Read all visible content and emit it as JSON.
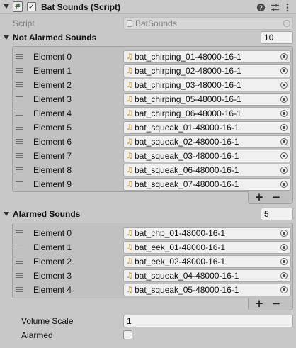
{
  "component": {
    "title": "Bat Sounds (Script)",
    "script_icon_glyph": "#",
    "enabled_glyph": "✓",
    "help_icon": "question-circle-icon",
    "presets_icon": "sliders-icon",
    "menu_icon": "kebab-menu-icon"
  },
  "script_row": {
    "label": "Script",
    "value": "BatSounds"
  },
  "not_alarmed": {
    "label": "Not Alarmed Sounds",
    "size": "10",
    "elements": [
      {
        "label": "Element 0",
        "value": "bat_chirping_01-48000-16-1"
      },
      {
        "label": "Element 1",
        "value": "bat_chirping_02-48000-16-1"
      },
      {
        "label": "Element 2",
        "value": "bat_chirping_03-48000-16-1"
      },
      {
        "label": "Element 3",
        "value": "bat_chirping_05-48000-16-1"
      },
      {
        "label": "Element 4",
        "value": "bat_chirping_06-48000-16-1"
      },
      {
        "label": "Element 5",
        "value": "bat_squeak_01-48000-16-1"
      },
      {
        "label": "Element 6",
        "value": "bat_squeak_02-48000-16-1"
      },
      {
        "label": "Element 7",
        "value": "bat_squeak_03-48000-16-1"
      },
      {
        "label": "Element 8",
        "value": "bat_squeak_06-48000-16-1"
      },
      {
        "label": "Element 9",
        "value": "bat_squeak_07-48000-16-1"
      }
    ]
  },
  "alarmed": {
    "label": "Alarmed Sounds",
    "size": "5",
    "elements": [
      {
        "label": "Element 0",
        "value": "bat_chp_01-48000-16-1"
      },
      {
        "label": "Element 1",
        "value": "bat_eek_01-48000-16-1"
      },
      {
        "label": "Element 2",
        "value": "bat_eek_02-48000-16-1"
      },
      {
        "label": "Element 3",
        "value": "bat_squeak_04-48000-16-1"
      },
      {
        "label": "Element 4",
        "value": "bat_squeak_05-48000-16-1"
      }
    ]
  },
  "list_buttons": {
    "add": "+",
    "remove": "−"
  },
  "volume_scale": {
    "label": "Volume Scale",
    "value": "1"
  },
  "alarmed_flag": {
    "label": "Alarmed",
    "checked": false
  },
  "audio_clip_icon": "♫"
}
